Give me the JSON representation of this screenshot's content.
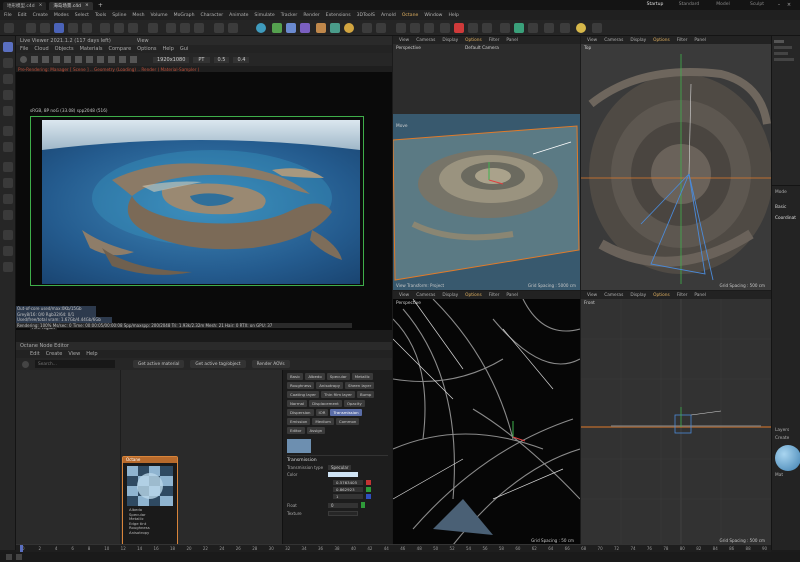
{
  "window": {
    "tabs": [
      {
        "label": "地形模型.c4d",
        "active": false
      },
      {
        "label": "海岛场景.c4d",
        "active": true
      }
    ],
    "new_tab": "+",
    "layouts": [
      "Startup",
      "Standard",
      "Model",
      "Sculpt"
    ],
    "active_layout": "Startup"
  },
  "menu": [
    "File",
    "Edit",
    "Create",
    "Modes",
    "Select",
    "Tools",
    "Spline",
    "Mesh",
    "Volume",
    "MoGraph",
    "Character",
    "Animate",
    "Simulate",
    "Tracker",
    "Render",
    "Extensions",
    "3DToolS",
    "Arnold",
    "Octane",
    "Window",
    "Help"
  ],
  "menu_highlight": "Octane",
  "live_viewer": {
    "title": "Live Viewer 2021.1.2 (117 days left)",
    "title_suffix": "View",
    "menu": [
      "File",
      "Cloud",
      "Objects",
      "Materials",
      "Compare",
      "Options",
      "Help",
      "Gui"
    ],
    "resolution": "1920x1080",
    "pt_mode": "PT",
    "val1": "0.5",
    "val2": "0.4",
    "status_line": "Pre-Rendering: Manager [ Scene ] .. Geometry (Loading) .. Render ( Material-Sampler )",
    "render_info": "sRGB, 8P noG (33.08) spp2048 (516)",
    "film_region": "Film region"
  },
  "stats": [
    "Out-of-core used/max:0Kb/15Gb",
    "Grey8/16: 0/0         Rgb32/64: 0/1",
    "Used/free/total vram: 1.67Gb/4.44Gb/6Gb",
    "Rendering: 100%    Ms/sec: 0    Time: 00:00:05/00:00:08    Spp/maxspp: 200/2048    Tri: 1.93k/2.32m    Mesh: 21    Hair: 0    RTX: on    GPU: 37"
  ],
  "node_editor": {
    "title": "Octane Node Editor",
    "menu": [
      "Edit",
      "Create",
      "View",
      "Help"
    ],
    "search_placeholder": "Search...",
    "buttons": [
      "Get active material",
      "Get active tag/object",
      "Render AOVs"
    ],
    "node_title": "Octane",
    "node_ports": [
      "Albedo",
      "Specular",
      "Metallic",
      "Edge tint",
      "Roughness",
      "Anisotropy"
    ],
    "chips": [
      [
        "Basic",
        "Albedo",
        "Specular",
        "Metallic"
      ],
      [
        "Roughness",
        "Anisotropy",
        "Sheen layer"
      ],
      [
        "Coating layer",
        "Thin film layer",
        "Bump"
      ],
      [
        "Normal",
        "Displacement",
        "Opacity"
      ],
      [
        "Dispersion",
        "IOR",
        "Transmission"
      ],
      [
        "Emission",
        "Medium",
        "Common"
      ],
      [
        "Editor",
        "Assign"
      ]
    ],
    "selected_chip": "Transmission",
    "section": "Transmission",
    "transmission_type_label": "Transmission type",
    "transmission_type_value": "Specular",
    "color_label": "Color",
    "values": [
      "0.5763405",
      "0.862923",
      "1"
    ],
    "float_label": "Float",
    "float_value": "0",
    "texture_label": "Texture"
  },
  "viewports": {
    "perspective": {
      "menu": [
        "View",
        "Cameras",
        "Display",
        "Options",
        "Filter",
        "Panel"
      ],
      "label": "Perspective",
      "camera": "Default Camera",
      "move_label": "Move",
      "footer_left": "View Transform: Project",
      "grid": "Grid Spacing : 5000 cm"
    },
    "top": {
      "menu": [
        "View",
        "Cameras",
        "Display",
        "Options",
        "Filter",
        "Panel"
      ],
      "label": "Top",
      "grid": "Grid Spacing : 500 cm"
    },
    "perspective2": {
      "menu": [
        "View",
        "Cameras",
        "Display",
        "Options",
        "Filter",
        "Panel"
      ],
      "label": "Perspective",
      "grid": "Grid Spacing : 50 cm"
    },
    "front": {
      "menu": [
        "View",
        "Cameras",
        "Display",
        "Options",
        "Filter",
        "Panel"
      ],
      "label": "Front",
      "grid": "Grid Spacing : 500 cm"
    },
    "menu_highlight": "Options"
  },
  "right_panel": {
    "mode": "Mode",
    "basic": "Basic",
    "coordinates": "Coordinat",
    "layers": "Layers",
    "create": "Create",
    "mat": "Mat"
  },
  "timeline": {
    "ticks": [
      "0",
      "2",
      "4",
      "6",
      "8",
      "10",
      "12",
      "14",
      "16",
      "18",
      "20",
      "22",
      "24",
      "26",
      "28",
      "30",
      "32",
      "34",
      "36",
      "38",
      "40",
      "42",
      "44",
      "46",
      "48",
      "50",
      "52",
      "54",
      "56",
      "58",
      "60",
      "62",
      "64",
      "66",
      "68",
      "70",
      "72",
      "74",
      "76",
      "78",
      "80",
      "82",
      "84",
      "86",
      "88",
      "90"
    ]
  },
  "colors": {
    "accent": "#e0b060",
    "render_frame": "#3fae4a",
    "selected_chip": "#5a6da8"
  }
}
